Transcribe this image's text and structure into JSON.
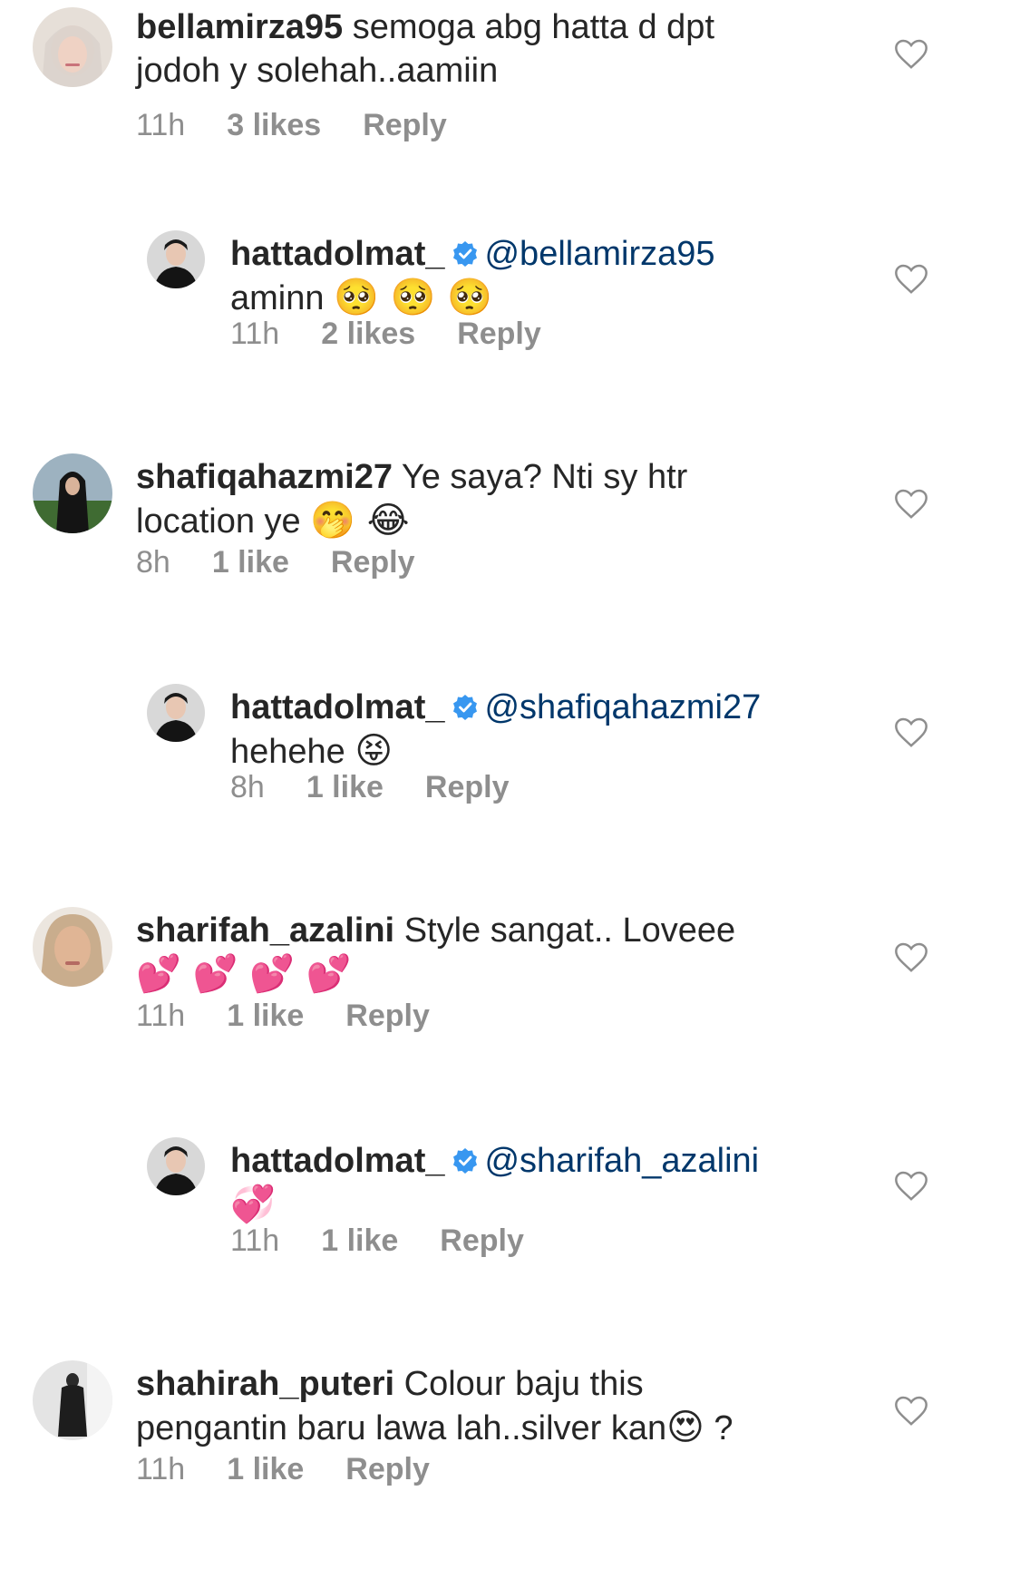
{
  "comments": [
    {
      "username": "bellamirza95",
      "verified": false,
      "mention": "",
      "text": "semoga abg hatta d dpt",
      "text2": "jodoh y solehah..aamiin",
      "emoji": "",
      "time": "11h",
      "likes": "3 likes",
      "reply": "Reply"
    },
    {
      "username": "hattadolmat_",
      "verified": true,
      "mention": "@bellamirza95",
      "text": "aminn",
      "emoji": "🥺 🥺 🥺",
      "time": "11h",
      "likes": "2 likes",
      "reply": "Reply"
    },
    {
      "username": "shafiqahazmi27",
      "verified": false,
      "mention": "",
      "text": "Ye saya?  Nti sy htr",
      "text2": "location ye",
      "emoji": "🤭 😂",
      "time": "8h",
      "likes": "1 like",
      "reply": "Reply"
    },
    {
      "username": "hattadolmat_",
      "verified": true,
      "mention": "@shafiqahazmi27",
      "text": "hehehe",
      "emoji": "😝",
      "time": "8h",
      "likes": "1 like",
      "reply": "Reply"
    },
    {
      "username": "sharifah_azalini",
      "verified": false,
      "mention": "",
      "text": "Style sangat.. Loveee",
      "emoji": "💕 💕 💕 💕",
      "time": "11h",
      "likes": "1 like",
      "reply": "Reply"
    },
    {
      "username": "hattadolmat_",
      "verified": true,
      "mention": "@sharifah_azalini",
      "text": "",
      "emoji": "💞",
      "time": "11h",
      "likes": "1 like",
      "reply": "Reply"
    },
    {
      "username": "shahirah_puteri",
      "verified": false,
      "mention": "",
      "text": "Colour baju this",
      "text2": "pengantin baru lawa lah..silver kan",
      "emoji": "😍",
      "text3": "?",
      "time": "11h",
      "likes": "1 like",
      "reply": "Reply"
    }
  ],
  "colors": {
    "text": "#262626",
    "meta": "#8e8e8e",
    "mention": "#00376b",
    "verified": "#3897f0"
  },
  "icons": {
    "like": "heart-outline-icon",
    "verified": "verified-badge-icon"
  }
}
